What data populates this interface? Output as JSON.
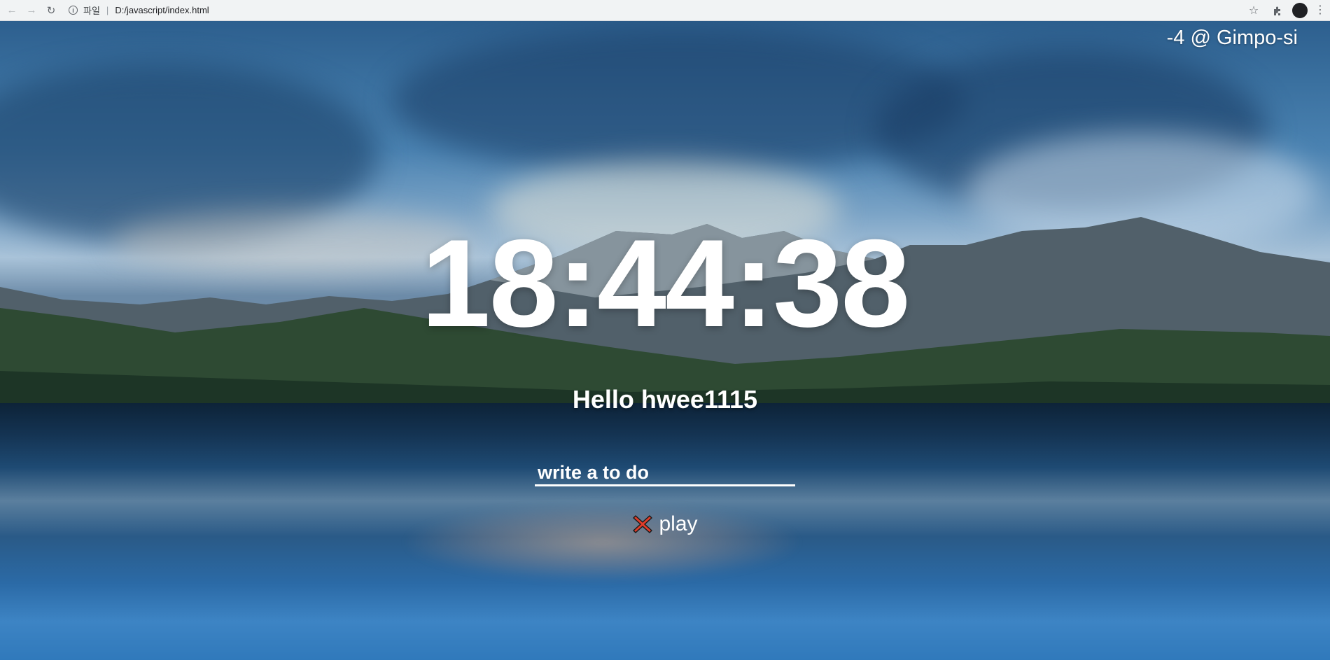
{
  "browser": {
    "scheme_label": "파일",
    "url": "D:/javascript/index.html"
  },
  "weather": {
    "text": "-4 @ Gimpo-si"
  },
  "clock": {
    "time": "18:44:38"
  },
  "greeting": {
    "text": "Hello hwee1115"
  },
  "todo": {
    "placeholder": "write a to do",
    "items": [
      {
        "label": "play"
      }
    ]
  },
  "colors": {
    "text": "#ffffff",
    "delete_icon": "#e03c2a"
  }
}
